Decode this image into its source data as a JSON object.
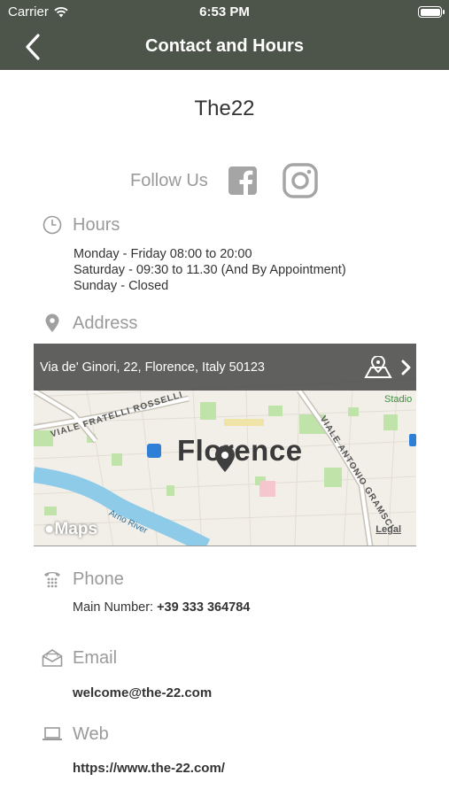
{
  "status_bar": {
    "carrier": "Carrier",
    "time": "6:53 PM",
    "icons": [
      "wifi-icon",
      "battery-icon"
    ]
  },
  "nav": {
    "title": "Contact and Hours",
    "back_icon": "chevron-left-icon"
  },
  "business_name": "The22",
  "social": {
    "label": "Follow Us",
    "icons": [
      "facebook-icon",
      "instagram-icon"
    ]
  },
  "hours": {
    "label": "Hours",
    "icon": "clock-icon",
    "lines": [
      "Monday - Friday 08:00 to 20:00",
      "Saturday - 09:30 to 11.30 (And By Appointment)",
      "Sunday - Closed"
    ]
  },
  "address": {
    "label": "Address",
    "icon": "location-pin-icon",
    "map": {
      "address_text": "Via de' Ginori, 22, Florence, Italy 50123",
      "city_label": "Florence",
      "maps_logo": "Maps",
      "legal": "Legal",
      "road_labels": [
        "VIALE FRATELLI ROSSELLI",
        "VIALE ANTONIO GRAMSCI"
      ],
      "river_label": "Arno River",
      "poi_label": "Stadio"
    }
  },
  "phone": {
    "label": "Phone",
    "icon": "telephone-icon",
    "prefix": "Main Number:",
    "number": "+39 333 364784"
  },
  "email": {
    "label": "Email",
    "icon": "envelope-icon",
    "value": "welcome@the-22.com"
  },
  "web": {
    "label": "Web",
    "icon": "laptop-icon",
    "value": "https://www.the-22.com/"
  },
  "colors": {
    "header": "#4d5449",
    "label_gray": "#9a9a9a",
    "text": "#333333"
  }
}
